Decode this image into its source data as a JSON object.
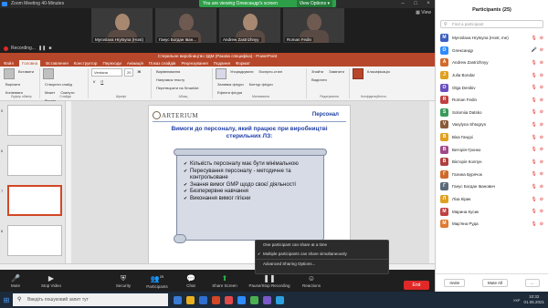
{
  "zoom": {
    "window_title": "Zoom Meeting 40-Minutes",
    "banner_text": "You are viewing Олександр's screen",
    "view_options_label": "View Options ▾",
    "view_label": "View",
    "recording_label": "Recording...",
    "thumbnails": [
      {
        "name": "Myroslava Hrytsyna (Host)"
      },
      {
        "name": "Ганус Богдан Іван..."
      },
      {
        "name": "Andrew Zastrizhnyy"
      },
      {
        "name": "Roman Fedin"
      }
    ]
  },
  "ppt": {
    "title": "Стерильне виробництво ЗДМ (Ракова специфіка) - PowerPoint",
    "tabs": [
      "Файл",
      "Головна",
      "Вставлення",
      "Конструктор",
      "Переходи",
      "Анімація",
      "Показ слайдів",
      "Рецензування",
      "Подання",
      "Формат"
    ],
    "ribbon": {
      "groups": [
        {
          "label": "Буфер обміну",
          "items": [
            "Вставити",
            "Вирізати",
            "Копіювати"
          ]
        },
        {
          "label": "Слайди",
          "items": [
            "Створити слайд",
            "Макет",
            "Скинути",
            "Розділ"
          ]
        },
        {
          "label": "Шрифт",
          "items": [
            "Verdana",
            "20",
            "Ж",
            "К",
            "П"
          ]
        },
        {
          "label": "Абзац",
          "items": [
            "Вирівнювання",
            "Напрямок тексту",
            "Перетворити на SmartArt"
          ]
        },
        {
          "label": "Малювання",
          "items": [
            "Упорядкувати",
            "Експрес-стилі",
            "Заливка фігури",
            "Контур фігури",
            "Ефекти фігури"
          ]
        },
        {
          "label": "Редагування",
          "items": [
            "Знайти",
            "Замінити",
            "Виділити"
          ]
        },
        {
          "label": "Конфіденційність",
          "items": [
            "Класифікація"
          ]
        }
      ]
    },
    "slide_numbers": [
      "5",
      "6",
      "7",
      "8"
    ],
    "slide": {
      "logo": "ARTERIUM",
      "section": "Персонал",
      "heading": "Вимоги до персоналу, який працює при виробництві стерильних ЛЗ:",
      "bullets": [
        "Кількість персоналу має бути мінімальною",
        "Пересування персоналу - методичне та контрольоване",
        "Знання вимог GMP щодо своєї діяльності",
        "Безперервне навчання",
        "Виконання вимог гігієни"
      ]
    }
  },
  "share_popup": {
    "option1": "One participant can share at a time",
    "option2": "Multiple participants can share simultaneously",
    "option3": "Advanced Sharing Options..."
  },
  "toolbar": {
    "mute": "Mute",
    "stop_video": "Stop Video",
    "security": "Security",
    "participants": "Participants",
    "participants_count": "25",
    "chat": "Chat",
    "share_screen": "Share Screen",
    "record": "Pause/Stop Recording",
    "reactions": "Reactions",
    "end": "End"
  },
  "taskbar": {
    "search_placeholder": "Введіть пошуковий запит тут",
    "time": "10:32",
    "date": "01.06.2021",
    "lang": "УКР"
  },
  "participants_panel": {
    "title": "Participants (25)",
    "search_placeholder": "Find a participant",
    "list": [
      {
        "name": "Myroslava Hrytsyna (Host, me)",
        "color": "#3b5fc0",
        "initial": "M",
        "mic_on": false
      },
      {
        "name": "Олександр",
        "color": "#2d8cff",
        "initial": "О",
        "mic_on": true
      },
      {
        "name": "Andrew Zastrizhnyy",
        "color": "#d06a2a",
        "initial": "A",
        "mic_on": false
      },
      {
        "name": "Julia Bondar",
        "color": "#e0a020",
        "initial": "J",
        "mic_on": false
      },
      {
        "name": "Olga Denikiv",
        "color": "#6b4fbf",
        "initial": "O",
        "mic_on": false
      },
      {
        "name": "Roman Fedin",
        "color": "#c04040",
        "initial": "R",
        "mic_on": false
      },
      {
        "name": "Solomiia Datsko",
        "color": "#3a9a5a",
        "initial": "S",
        "mic_on": false
      },
      {
        "name": "Vasylyna Shtogryn",
        "color": "#8a5a3a",
        "initial": "V",
        "mic_on": false
      },
      {
        "name": "Віка Гандзі",
        "color": "#e0a020",
        "initial": "В",
        "mic_on": false
      },
      {
        "name": "Виторія Гронко",
        "color": "#a04a8a",
        "initial": "В",
        "mic_on": false
      },
      {
        "name": "Вікторія Колпун",
        "color": "#b04040",
        "initial": "В",
        "mic_on": false
      },
      {
        "name": "Галина Бурячок",
        "color": "#d06a2a",
        "initial": "Г",
        "mic_on": false
      },
      {
        "name": "Ганус Богдан Іванович",
        "color": "#5a6a7a",
        "initial": "Г",
        "mic_on": false
      },
      {
        "name": "Ліза Кірик",
        "color": "#e0a020",
        "initial": "Л",
        "mic_on": false
      },
      {
        "name": "Марина Кусик",
        "color": "#c04040",
        "initial": "М",
        "mic_on": false
      },
      {
        "name": "Мар'яна Руда",
        "color": "#e07a30",
        "initial": "М",
        "mic_on": false
      }
    ],
    "invite": "Invite",
    "mute_all": "Mute All",
    "more": "..."
  }
}
